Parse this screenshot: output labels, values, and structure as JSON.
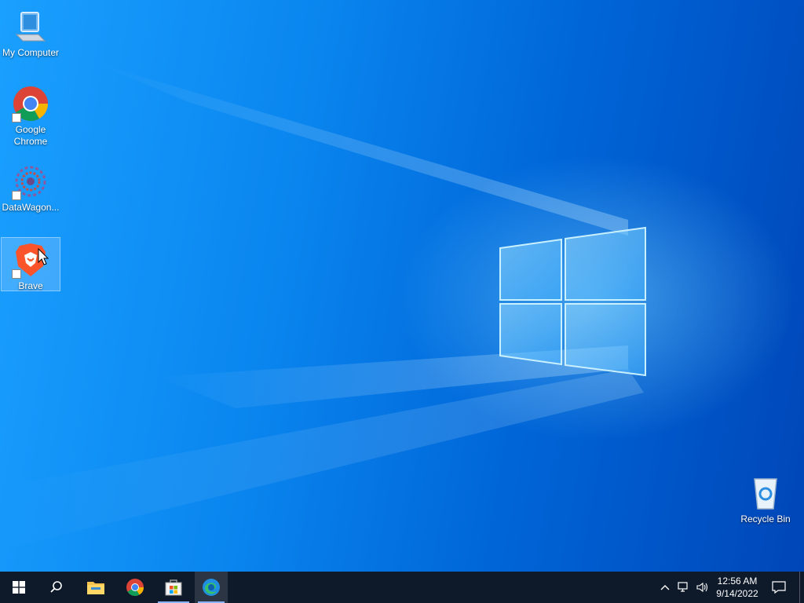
{
  "desktop": {
    "icons": [
      {
        "label": "My Computer",
        "icon": "computer-icon"
      },
      {
        "label": "Google Chrome",
        "icon": "chrome-icon"
      },
      {
        "label": "DataWagon...",
        "icon": "datawagon-icon"
      },
      {
        "label": "Brave",
        "icon": "brave-icon"
      },
      {
        "label": "Recycle Bin",
        "icon": "recycle-bin-icon"
      }
    ]
  },
  "taskbar": {
    "apps": [
      "start-icon",
      "search-icon",
      "file-explorer-icon",
      "chrome-icon",
      "microsoft-store-icon",
      "edge-icon"
    ],
    "clock": {
      "time": "12:56 AM",
      "date": "9/14/2022"
    }
  },
  "colors": {
    "taskbar": "#0e1a2a",
    "desktop_accent": "#0a86ef"
  }
}
